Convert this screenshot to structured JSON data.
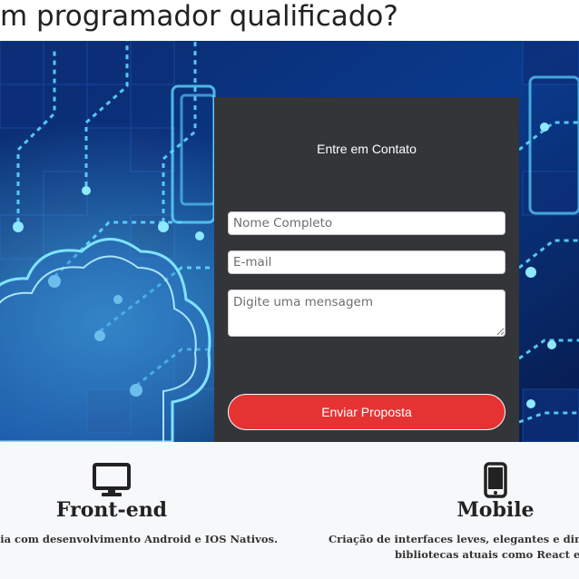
{
  "page": {
    "title": "m programador qualificado?"
  },
  "contact_form": {
    "title": "Entre em Contato",
    "name_placeholder": "Nome Completo",
    "email_placeholder": "E-mail",
    "message_placeholder": "Digite uma mensagem",
    "submit_label": "Enviar Proposta"
  },
  "features": [
    {
      "icon": "monitor-icon",
      "title": "Front-end",
      "text_lines": [
        "cia com desenvolvimento Android e IOS Nativos."
      ]
    },
    {
      "icon": "mobile-phone-icon",
      "title": "Mobile",
      "text_lines": [
        "Criação de interfaces leves, elegantes e dinâm",
        "bibliotecas atuais como React e V"
      ]
    }
  ],
  "colors": {
    "card_bg": "#333539",
    "button_red": "#e53333",
    "hero_blue": "#061a4a",
    "circuit_cyan": "#5fd8ff"
  }
}
